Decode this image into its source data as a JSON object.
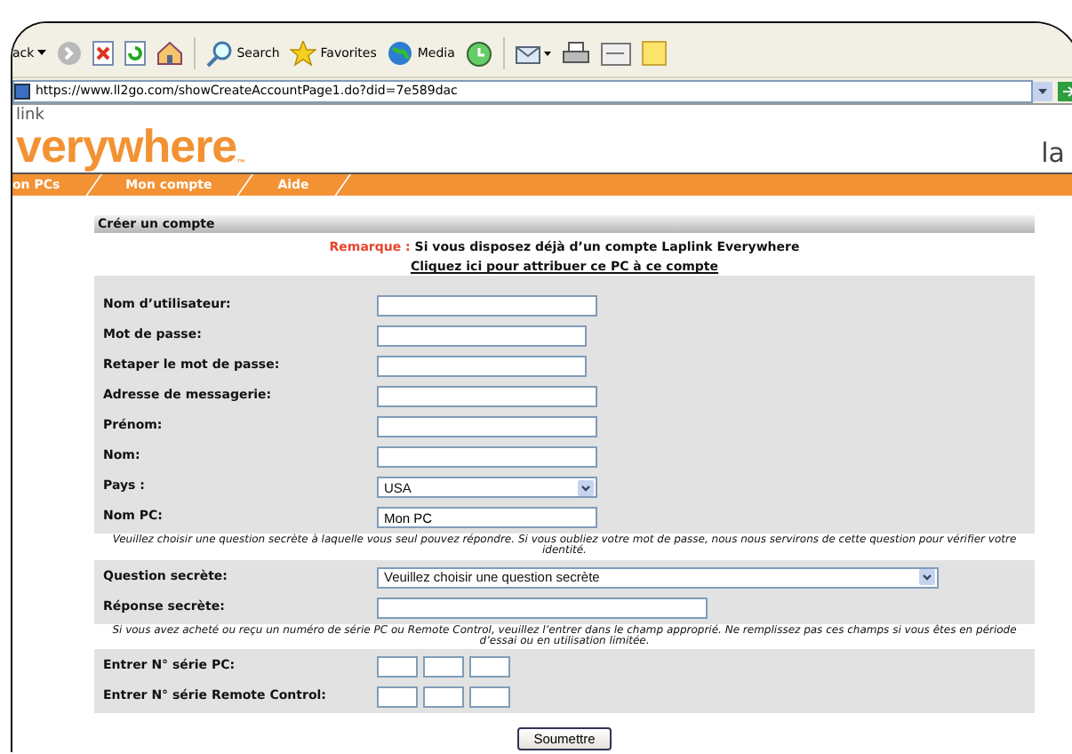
{
  "toolbar": {
    "back": "ack",
    "buttons": [
      {
        "kind": "search",
        "label": "Search"
      },
      {
        "kind": "favorites",
        "label": "Favorites"
      },
      {
        "kind": "media",
        "label": "Media"
      }
    ]
  },
  "address": {
    "url": "https://www.ll2go.com/showCreateAccountPage1.do?did=7e589dac"
  },
  "logo": {
    "small": "link",
    "large": "verywhere",
    "mark": "™",
    "corner": "la"
  },
  "nav": [
    {
      "label": "on PCs"
    },
    {
      "label": "Mon compte"
    },
    {
      "label": "Aide"
    }
  ],
  "form": {
    "title": "Créer un compte",
    "remark_label": "Remarque :",
    "remark": "Si vous disposez déjà d’un compte Laplink Everywhere",
    "link": "Cliquez ici pour attribuer ce PC à ce compte",
    "fields": [
      {
        "kind": "text",
        "label": "Nom d’utilisateur:"
      },
      {
        "kind": "password",
        "label": "Mot de passe:"
      },
      {
        "kind": "password",
        "label": "Retaper le mot de passe:"
      },
      {
        "kind": "text",
        "label": "Adresse de messagerie:"
      },
      {
        "kind": "text",
        "label": "Prénom:"
      },
      {
        "kind": "text",
        "label": "Nom:"
      },
      {
        "kind": "select",
        "label": "Pays :",
        "value": "USA"
      },
      {
        "kind": "text",
        "label": "Nom PC:",
        "value": "Mon PC"
      }
    ],
    "note1": "Veuillez choisir une question secrète à laquelle vous seul pouvez répondre. Si vous oubliez votre mot de passe, nous nous servirons de cette question pour vérifier votre identité.",
    "secret": [
      {
        "kind": "wideselect",
        "label": "Question secrète:",
        "value": "Veuillez choisir une question secrète"
      },
      {
        "kind": "wide",
        "label": "Réponse secrète:"
      }
    ],
    "note2": "Si vous avez acheté ou reçu un numéro de série PC ou Remote Control, veuillez l’entrer dans le champ approprié. Ne remplissez pas ces champs si vous êtes en période d’essai ou en utilisation limitée.",
    "serials": [
      {
        "label": "Entrer N° série PC:"
      },
      {
        "label": "Entrer N° série Remote Control:"
      }
    ],
    "submit": "Soumettre"
  }
}
